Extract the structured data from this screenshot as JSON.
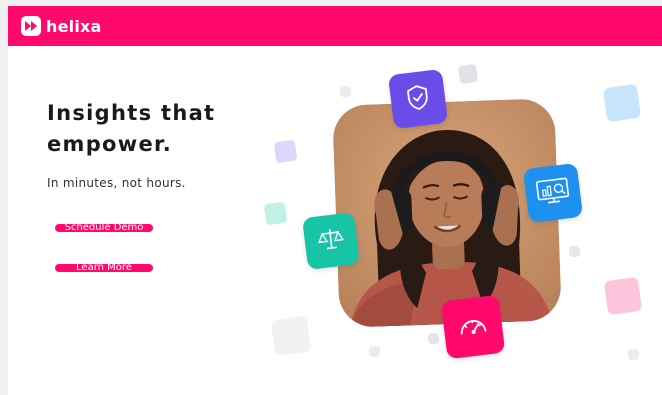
{
  "brand": {
    "name": "helixa",
    "color": "#ff0a6c"
  },
  "hero": {
    "headline": "Insights that empower.",
    "subline": "In minutes, not hours.",
    "buttons": {
      "demo": "Schedule Demo",
      "learn": "Learn More"
    }
  },
  "illustration": {
    "photo": "woman-with-headphones-photo",
    "tiles": [
      {
        "icon": "shield-check-icon",
        "color": "#6a4ce8"
      },
      {
        "icon": "analytics-monitor-icon",
        "color": "#1e90f0"
      },
      {
        "icon": "scales-icon",
        "color": "#17c4a6"
      },
      {
        "icon": "speedometer-icon",
        "color": "#ff0a6c"
      }
    ]
  }
}
